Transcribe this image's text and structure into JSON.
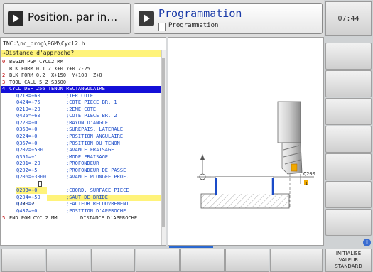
{
  "header": {
    "mode1_label": "Position. par in…",
    "mode2_label": "Programmation",
    "mode2_sub": "Programmation",
    "clock": "07:44"
  },
  "program": {
    "path": "TNC:\\nc_prog\\PGM\\Cycl2.h",
    "prompt": "→Distance d'approche?",
    "lines": [
      {
        "n": "0",
        "code": "BEGIN PGM CYCL2 MM"
      },
      {
        "n": "1",
        "code": "BLK FORM 0.1 Z X+0 Y+0 Z-25"
      },
      {
        "n": "2",
        "code": "BLK FORM 0.2  X+150  Y+100  Z+0"
      },
      {
        "n": "3",
        "code": "TOOL CALL 5 Z S3500"
      },
      {
        "n": "4",
        "code": "CYCL DEF 256 TENON RECTANGULAIRE"
      }
    ],
    "params": [
      {
        "p": "Q218=+60",
        "c": ";1ER COTE"
      },
      {
        "p": "Q424=+75",
        "c": ";COTE PIECE BR. 1"
      },
      {
        "p": "Q219=+20",
        "c": ";2EME COTE"
      },
      {
        "p": "Q425=+60",
        "c": ";COTE PIECE BR. 2"
      },
      {
        "p": "Q220=+0",
        "c": ";RAYON D'ANGLE"
      },
      {
        "p": "Q368=+0",
        "c": ";SUREPAIS. LATERALE"
      },
      {
        "p": "Q224=+0",
        "c": ";POSITION ANGULAIRE"
      },
      {
        "p": "Q367=+0",
        "c": ";POSITION DU TENON"
      },
      {
        "p": "Q207=+500",
        "c": ";AVANCE FRAISAGE"
      },
      {
        "p": "Q351=+1",
        "c": ";MODE FRAISAGE"
      },
      {
        "p": "Q201=-20",
        "c": ";PROFONDEUR"
      },
      {
        "p": "Q202=+5",
        "c": ";PROFONDEUR DE PASSE"
      },
      {
        "p": "Q206=+3000",
        "c": ";AVANCE PLONGEE PROF."
      }
    ],
    "edit_line": {
      "p": "Q200=2",
      "c": "DISTANCE D'APPROCHE"
    },
    "params2": [
      {
        "p": "Q203=+0",
        "c": ";COORD. SURFACE PIECE"
      },
      {
        "p": "Q204=+50",
        "c": ";SAUT DE BRIDE"
      },
      {
        "p": "Q370=+1",
        "c": ";FACTEUR RECOUVREMENT"
      },
      {
        "p": "Q437=+0",
        "c": ";POSITION D'APPROCHE"
      }
    ],
    "end_line": {
      "n": "5",
      "code": "END PGM CYCL2 MM"
    }
  },
  "graphic": {
    "param_label": "Q200",
    "marker_label": "1"
  },
  "softkeys": {
    "default_value": "INITIALISE\nVALEUR\nSTANDARD"
  },
  "colors": {
    "accent_blue": "#1410d8",
    "edit_yellow": "#fff37a",
    "q200_orange": "#f0a800"
  }
}
